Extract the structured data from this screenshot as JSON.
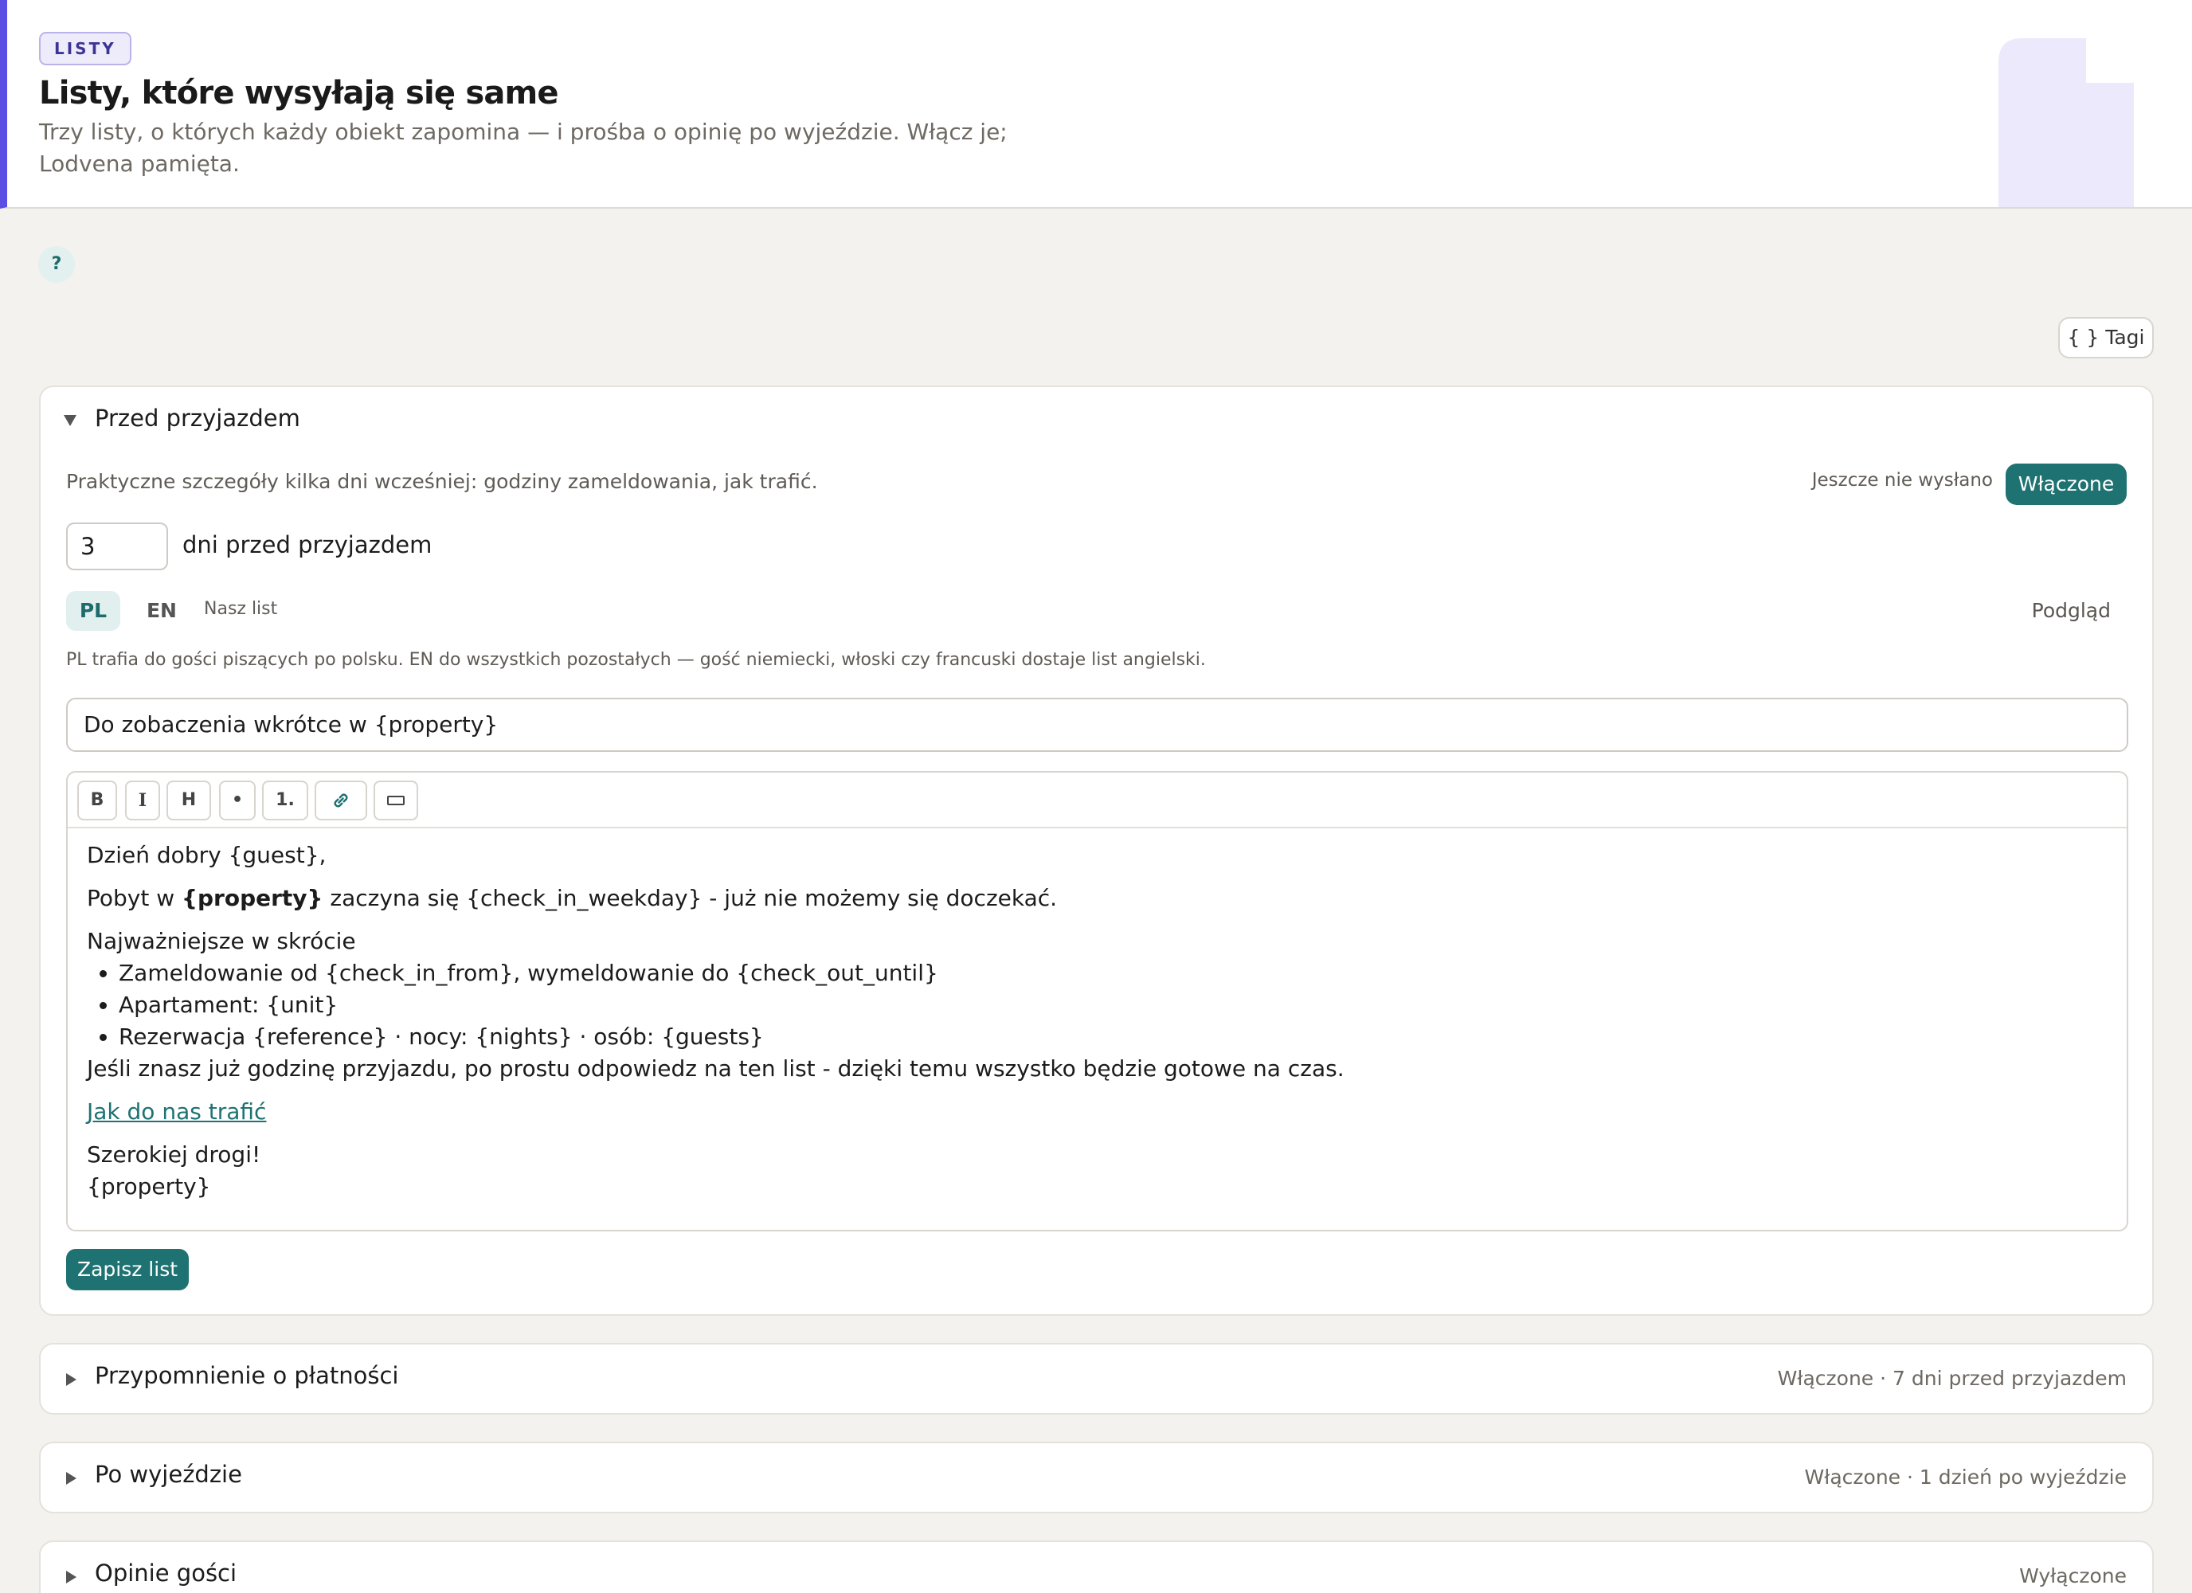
{
  "header": {
    "badge": "LISTY",
    "title": "Listy, które wysyłają się same",
    "subtitle": "Trzy listy, o których każdy obiekt zapomina — i prośba o opinię po wyjeździe. Włącz je; Lodvena pamięta."
  },
  "help_label": "?",
  "tags_button": "{ } Tagi",
  "colors": {
    "accent": "#5b4fe3",
    "primary": "#1f7272",
    "background": "#f3f2ef"
  },
  "panels": [
    {
      "title": "Przed przyjazdem",
      "expanded": true,
      "description": "Praktyczne szczegóły kilka dni wcześniej: godziny zameldowania, jak trafić.",
      "status": "Jeszcze nie wysłano",
      "toggle_label": "Włączone",
      "days_value": "3",
      "days_label": "dni przed przyjazdem",
      "languages": {
        "pl": "PL",
        "en": "EN",
        "active": "PL"
      },
      "our_letter": "Nasz list",
      "preview": "Podgląd",
      "lang_info": "PL trafia do gości piszących po polsku. EN do wszystkich pozostałych — gość niemiecki, włoski czy francuski dostaje list angielski.",
      "subject": "Do zobaczenia wkrótce w {property}",
      "toolbar": {
        "bold": "B",
        "italic": "I",
        "heading": "H",
        "bullet": "•",
        "numbered": "1.",
        "link_icon": "link-icon",
        "divider_icon": "horizontal-rule-icon"
      },
      "body": {
        "greeting": "Dzień dobry {guest},",
        "line1_pre": "Pobyt w ",
        "line1_bold": "{property}",
        "line1_post": " zaczyna się {check_in_weekday} - już nie możemy się doczekać.",
        "summary_heading": "Najważniejsze w skrócie",
        "bullets": [
          "Zameldowanie od {check_in_from}, wymeldowanie do {check_out_until}",
          "Apartament: {unit}",
          "Rezerwacja {reference} · nocy: {nights} · osób: {guests}"
        ],
        "arrival_note": "Jeśli znasz już godzinę przyjazdu, po prostu odpowiedz na ten list - dzięki temu wszystko będzie gotowe na czas.",
        "link_text": "Jak do nas trafić",
        "closing": "Szerokiej drogi!",
        "signature": "{property}"
      },
      "save_label": "Zapisz list"
    },
    {
      "title": "Przypomnienie o płatności",
      "expanded": false,
      "meta": "Włączone · 7 dni przed przyjazdem"
    },
    {
      "title": "Po wyjeździe",
      "expanded": false,
      "meta": "Włączone · 1 dzień po wyjeździe"
    },
    {
      "title": "Opinie gości",
      "expanded": false,
      "meta": "Wyłączone"
    }
  ]
}
